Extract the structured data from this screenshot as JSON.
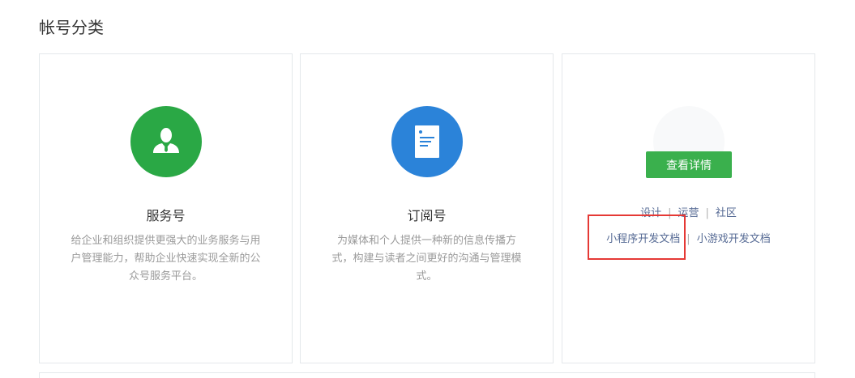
{
  "section": {
    "title": "帐号分类"
  },
  "cards": [
    {
      "name": "服务号",
      "description": "给企业和组织提供更强大的业务服务与用户管理能力，帮助企业快速实现全新的公众号服务平台。",
      "icon": "person-icon",
      "color": "#2aa845"
    },
    {
      "name": "订阅号",
      "description": "为媒体和个人提供一种新的信息传播方式，构建与读者之间更好的沟通与管理模式。",
      "icon": "document-icon",
      "color": "#2b83d9"
    },
    {
      "button": "查看详情",
      "links_row1": [
        "设计",
        "运营",
        "社区"
      ],
      "links_row2": [
        "小程序开发文档",
        "小游戏开发文档"
      ]
    }
  ],
  "colors": {
    "button": "#3ab04d",
    "link": "#576b95",
    "highlight": "#e53935"
  }
}
